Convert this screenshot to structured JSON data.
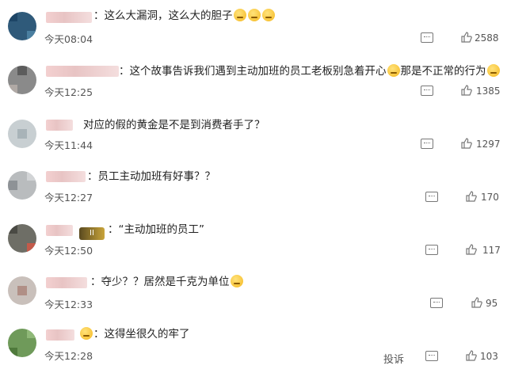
{
  "comments": [
    {
      "text": "：这么大漏洞，这么大的胆子",
      "emoji_count": 3,
      "time": "今天08:04",
      "likes": "2588"
    },
    {
      "text": "：这个故事告诉我们遇到主动加班的员工老板别急着开心",
      "text2": "那是不正常的行为",
      "time": "今天12:25",
      "likes": "1385"
    },
    {
      "text": "对应的假的黄金是不是到消费者手了？",
      "time": "今天11:44",
      "likes": "1297"
    },
    {
      "text": "：员工主动加班有好事？？",
      "time": "今天12:27",
      "likes": "170"
    },
    {
      "text": "：“主动加班的员工”",
      "badge": "II",
      "time": "今天12:50",
      "likes": "117"
    },
    {
      "text": "：夺少？？居然是千克为单位",
      "time": "今天12:33",
      "likes": "95"
    },
    {
      "text": "：这得坐很久的牢了",
      "time": "今天12:28",
      "likes": "103"
    }
  ],
  "report_label": "投诉",
  "icons": {
    "reply": "comment-icon",
    "like": "thumbs-up-icon",
    "emoji": "emoji-icon"
  }
}
